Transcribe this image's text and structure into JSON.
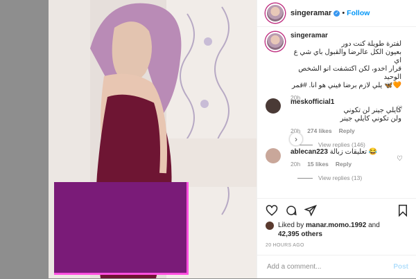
{
  "header": {
    "username": "singeramar",
    "separator": "•",
    "follow_label": "Follow"
  },
  "caption": {
    "username": "singeramar",
    "text_lines": [
      "لفترة طويلة كنت دور",
      "بعيون الكل عالرضا والقبول باي شي ع اي",
      "قرار اخدو، لكن اكتشفت انو الشخص الوحيد",
      "🧡🦋 يلي لازم برضا فيني هو انا. #قمر"
    ],
    "time": "20h"
  },
  "comments": [
    {
      "username": "meskofficial1",
      "text_lines": [
        "كايلي جينر لن تكوني",
        "ولن تكوني كايلي جينر"
      ],
      "time": "20h",
      "likes": "274 likes",
      "reply_label": "Reply",
      "view_replies": "View replies (146)"
    },
    {
      "username": "ablecan223",
      "text_lines": [
        "تعليقات زبالة 😂"
      ],
      "time": "20h",
      "likes": "15 likes",
      "reply_label": "Reply",
      "view_replies": "View replies (13)"
    }
  ],
  "likes": {
    "prefix": "Liked by",
    "liker": "manar.momo.1992",
    "and": "and",
    "others": "42,395 others"
  },
  "timestamp": "20 HOURS AGO",
  "add_comment": {
    "placeholder": "Add a comment...",
    "post_label": "Post"
  },
  "icons": {
    "next": "chevron-right-icon",
    "like": "heart-icon",
    "comment": "comment-icon",
    "share": "paper-plane-icon",
    "save": "bookmark-icon"
  },
  "colors": {
    "accent": "#0095f6",
    "censor": "#7a1b78",
    "censor_border": "#ff4fe0"
  }
}
